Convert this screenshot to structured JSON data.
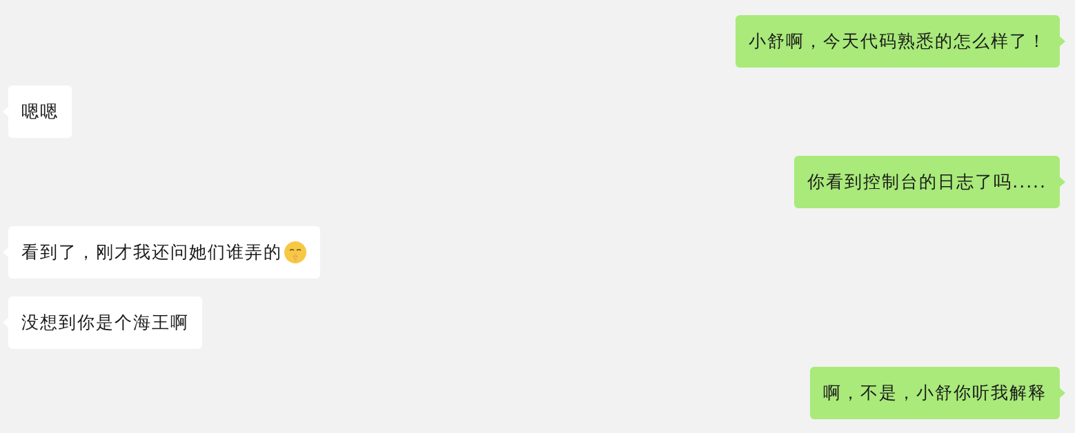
{
  "messages": [
    {
      "kind": "sent",
      "text": "小舒啊，今天代码熟悉的怎么样了！",
      "emoji": false
    },
    {
      "kind": "received",
      "text": "嗯嗯",
      "emoji": false
    },
    {
      "kind": "sent",
      "text": "你看到控制台的日志了吗.....",
      "emoji": false
    },
    {
      "kind": "received",
      "text": "看到了，刚才我还问她们谁弄的",
      "emoji": true
    },
    {
      "kind": "received",
      "text": "没想到你是个海王啊",
      "emoji": false
    },
    {
      "kind": "sent",
      "text": "啊，不是，小舒你听我解释",
      "emoji": false
    }
  ]
}
